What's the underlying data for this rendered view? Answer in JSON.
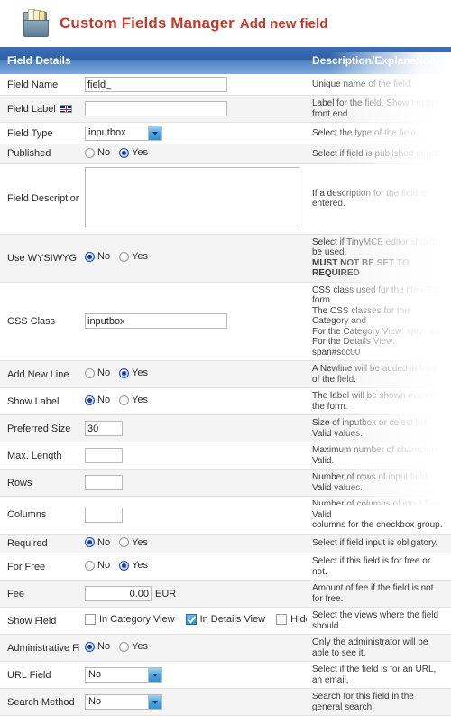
{
  "header": {
    "icon": "archive-folder-icon",
    "title": "Custom Fields Manager",
    "subtitle": "Add new field",
    "title_color": "#c0392b"
  },
  "table": {
    "col_field_details": "Field Details",
    "col_description": "Description/Explanation",
    "header_color": "#2f5fa6"
  },
  "options": {
    "no": "No",
    "yes": "Yes"
  },
  "rows": [
    {
      "label": "Field Name",
      "flag": false,
      "control": "text",
      "value": "field_",
      "description": "Unique name of the field."
    },
    {
      "label": "Field Label",
      "flag": true,
      "control": "text",
      "value": "",
      "description": "Label for the field. Shown in the front end."
    },
    {
      "label": "Field Type",
      "flag": false,
      "control": "select",
      "value": "inputbox",
      "description": "Select the type of the field."
    },
    {
      "label": "Published",
      "flag": false,
      "control": "radio",
      "selected": "Yes",
      "description": "Select if field is published or not."
    },
    {
      "label": "Field Description",
      "flag": true,
      "control": "textarea",
      "value": "",
      "description": "If a description for the field is entered."
    },
    {
      "label": "Use WYSIWYG Editor",
      "flag": false,
      "control": "radio",
      "selected": "No",
      "description": "Select if TinyMCE editor should be used.",
      "description2": "MUST NOT BE SET TO REQUIRED"
    },
    {
      "label": "CSS Class",
      "flag": false,
      "control": "text",
      "value": "inputbox",
      "description": "CSS class used for the New/Edit form.",
      "description2": "The CSS classes for the Category and",
      "description3": "For the Category View: span.scc",
      "description4": "For the Details View: span#scc00"
    },
    {
      "label": "Add New Line",
      "flag": false,
      "control": "radio",
      "selected": "Yes",
      "description": "A Newline will be added in front of the field."
    },
    {
      "label": "Show Label",
      "flag": false,
      "control": "radio",
      "selected": "No",
      "description": "The label will be shown even in the form."
    },
    {
      "label": "Preferred Size",
      "flag": false,
      "control": "text-small",
      "value": "30",
      "description": "Size of inputbox or select list. Valid values."
    },
    {
      "label": "Max. Length",
      "flag": false,
      "control": "text-small",
      "value": "",
      "description": "Maximum number of characters. Valid."
    },
    {
      "label": "Rows",
      "flag": false,
      "control": "text-small",
      "value": "",
      "description": "Number of rows of input field. Valid values."
    },
    {
      "label": "Columns",
      "flag": false,
      "control": "text-small",
      "value": "",
      "description": "Number of columns of input field. Valid",
      "description2": "columns for the checkbox group."
    },
    {
      "label": "Required",
      "flag": false,
      "control": "radio",
      "selected": "No",
      "description": "Select if field input is obligatory."
    },
    {
      "label": "For Free",
      "flag": false,
      "control": "radio",
      "selected": "Yes",
      "description": "Select if this field is for free or not."
    },
    {
      "label": "Fee",
      "flag": false,
      "control": "fee",
      "value": "0.00",
      "unit": "EUR",
      "description": "Amount of fee if the field is not for free."
    },
    {
      "label": "Show Field",
      "flag": false,
      "control": "checkboxes",
      "checkboxes": [
        {
          "label": "In Category View",
          "checked": false
        },
        {
          "label": "In Details View",
          "checked": true
        },
        {
          "label": "Hidden",
          "checked": false
        }
      ],
      "description": "Select the views where the field should."
    },
    {
      "label": "Administrative Field",
      "flag": false,
      "control": "radio",
      "selected": "No",
      "description": "Only the administrator will be able to see it."
    },
    {
      "label": "URL Field",
      "flag": false,
      "control": "select",
      "value": "No",
      "description": "Select if the field is for an URL, an email."
    },
    {
      "label": "Search Method",
      "flag": false,
      "control": "select",
      "value": "No",
      "description": "Search for this field in the general search."
    }
  ]
}
